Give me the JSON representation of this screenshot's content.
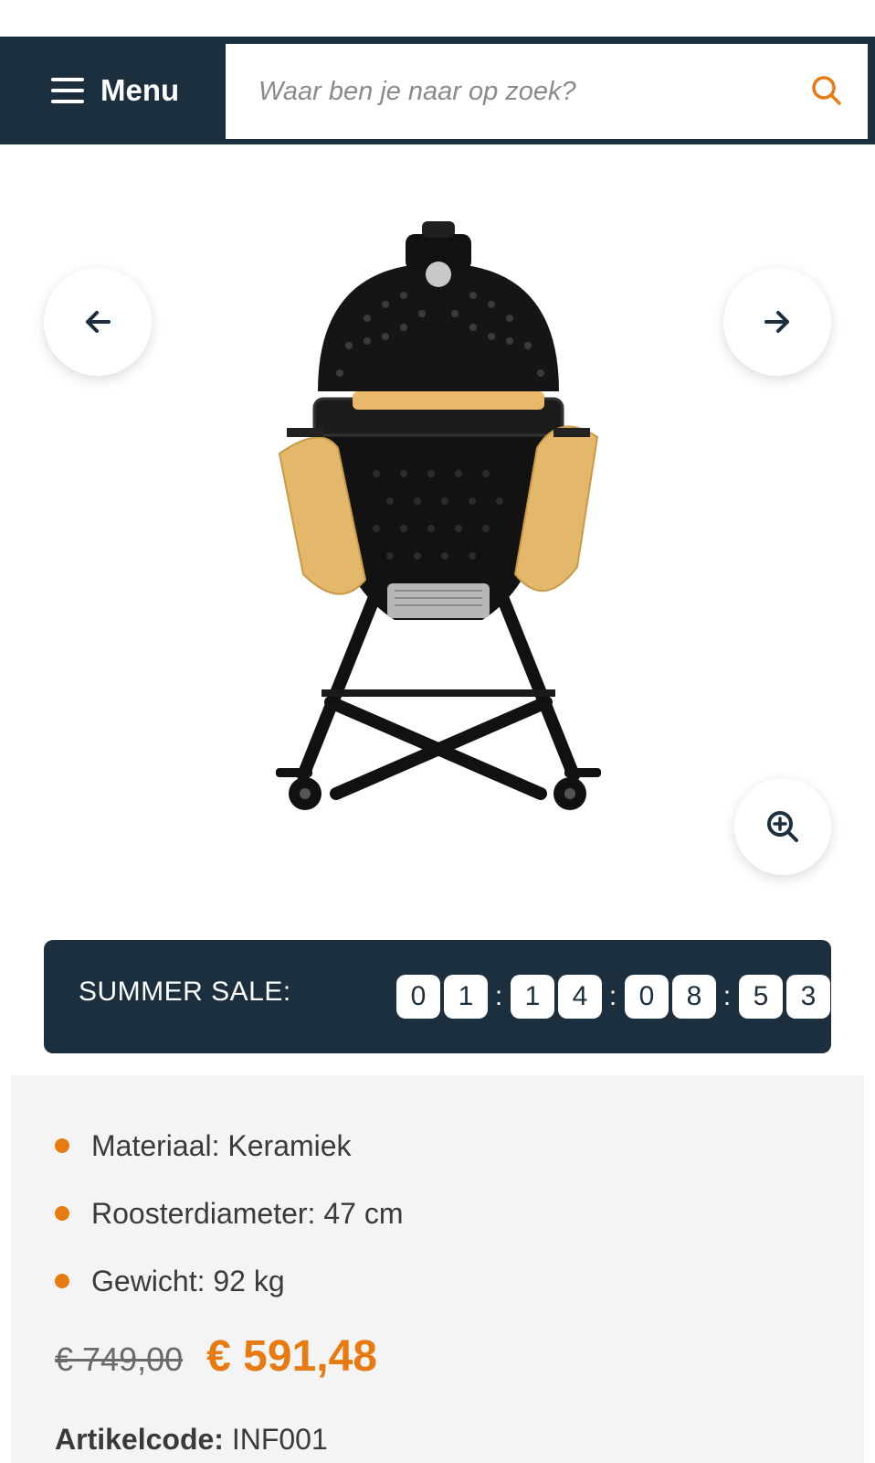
{
  "header": {
    "menu_label": "Menu",
    "search_placeholder": "Waar ben je naar op zoek?"
  },
  "gallery": {
    "prev_icon": "arrow-left-icon",
    "next_icon": "arrow-right-icon",
    "zoom_icon": "zoom-in-icon"
  },
  "sale": {
    "label": "SUMMER SALE:",
    "digits": [
      "0",
      "1",
      "1",
      "4",
      "0",
      "8",
      "5",
      "3"
    ],
    "separator": ":"
  },
  "specs": {
    "items": [
      "Materiaal: Keramiek",
      "Roosterdiameter: 47 cm",
      "Gewicht: 92 kg"
    ]
  },
  "pricing": {
    "old_price": "€ 749,00",
    "new_price": "€ 591,48"
  },
  "article": {
    "label": "Artikelcode:",
    "code": "INF001"
  },
  "colors": {
    "navy": "#1b2f3f",
    "accent": "#e87a12",
    "panel": "#f4f4f4"
  }
}
